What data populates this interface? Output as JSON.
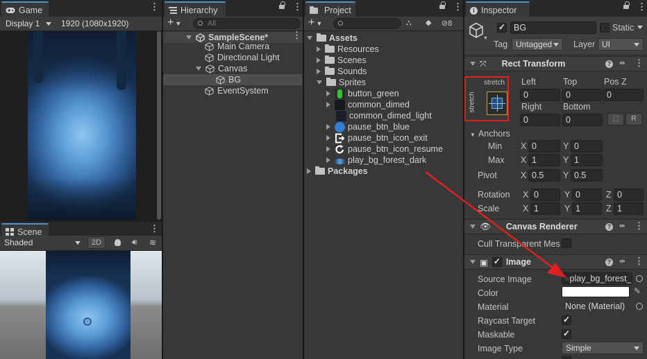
{
  "game": {
    "tab": "Game",
    "display": "Display 1",
    "resolution": "1920 (1080x1920)"
  },
  "scene": {
    "tab": "Scene",
    "shading": "Shaded",
    "mode2d": "2D"
  },
  "hierarchy": {
    "tab": "Hierarchy",
    "search_placeholder": "All",
    "items": [
      {
        "label": "SampleScene*"
      },
      {
        "label": "Main Camera"
      },
      {
        "label": "Directional Light"
      },
      {
        "label": "Canvas"
      },
      {
        "label": "BG"
      },
      {
        "label": "EventSystem"
      }
    ]
  },
  "project": {
    "tab": "Project",
    "hidden_count": "8",
    "items": [
      {
        "label": "Assets"
      },
      {
        "label": "Resources"
      },
      {
        "label": "Scenes"
      },
      {
        "label": "Sounds"
      },
      {
        "label": "Sprites"
      },
      {
        "label": "button_green",
        "icon": "green-button-sprite-icon",
        "color": "#36c236"
      },
      {
        "label": "common_dimed",
        "icon": "dark-sprite-icon",
        "color": "#15191f"
      },
      {
        "label": "common_dimed_light",
        "icon": "dark-sprite-icon",
        "color": "#1b2028"
      },
      {
        "label": "pause_btn_blue",
        "icon": "blue-button-sprite-icon",
        "color": "#2f7fd6"
      },
      {
        "label": "pause_btn_icon_exit",
        "icon": "exit-sprite-icon"
      },
      {
        "label": "pause_btn_icon_resume",
        "icon": "resume-sprite-icon"
      },
      {
        "label": "play_bg_forest_dark",
        "icon": "forest-bg-sprite-icon",
        "color": "#2d6fb8"
      },
      {
        "label": "Packages"
      }
    ]
  },
  "inspector": {
    "tab": "Inspector",
    "object_name": "BG",
    "static_label": "Static",
    "tag_label": "Tag",
    "tag_value": "Untagged",
    "layer_label": "Layer",
    "layer_value": "UI",
    "rect_transform": {
      "title": "Rect Transform",
      "anchor_preset_h": "stretch",
      "anchor_preset_v": "stretch",
      "left_label": "Left",
      "left": "0",
      "top_label": "Top",
      "top": "0",
      "posz_label": "Pos Z",
      "posz": "0",
      "right_label": "Right",
      "right": "0",
      "bottom_label": "Bottom",
      "bottom": "0",
      "raw_btn": "R",
      "anchors_label": "Anchors",
      "min_label": "Min",
      "min_x": "0",
      "min_y": "0",
      "max_label": "Max",
      "max_x": "1",
      "max_y": "1",
      "pivot_label": "Pivot",
      "pivot_x": "0.5",
      "pivot_y": "0.5",
      "rotation_label": "Rotation",
      "rot_x": "0",
      "rot_y": "0",
      "rot_z": "0",
      "scale_label": "Scale",
      "scale_x": "1",
      "scale_y": "1",
      "scale_z": "1",
      "x": "X",
      "y": "Y",
      "z": "Z"
    },
    "canvas_renderer": {
      "title": "Canvas Renderer",
      "cull_label": "Cull Transparent Mes"
    },
    "image": {
      "title": "Image",
      "source_label": "Source Image",
      "source_value": "play_bg_forest_",
      "color_label": "Color",
      "color_value": "#ffffff",
      "material_label": "Material",
      "material_value": "None (Material)",
      "raycast_label": "Raycast Target",
      "maskable_label": "Maskable",
      "type_label": "Image Type",
      "type_value": "Simple"
    }
  },
  "colors": {
    "highlight_box": "#e02020",
    "annotation_arrow": "#e02020",
    "selection": "#4d4d4d",
    "accent": "#4f8fd6"
  }
}
